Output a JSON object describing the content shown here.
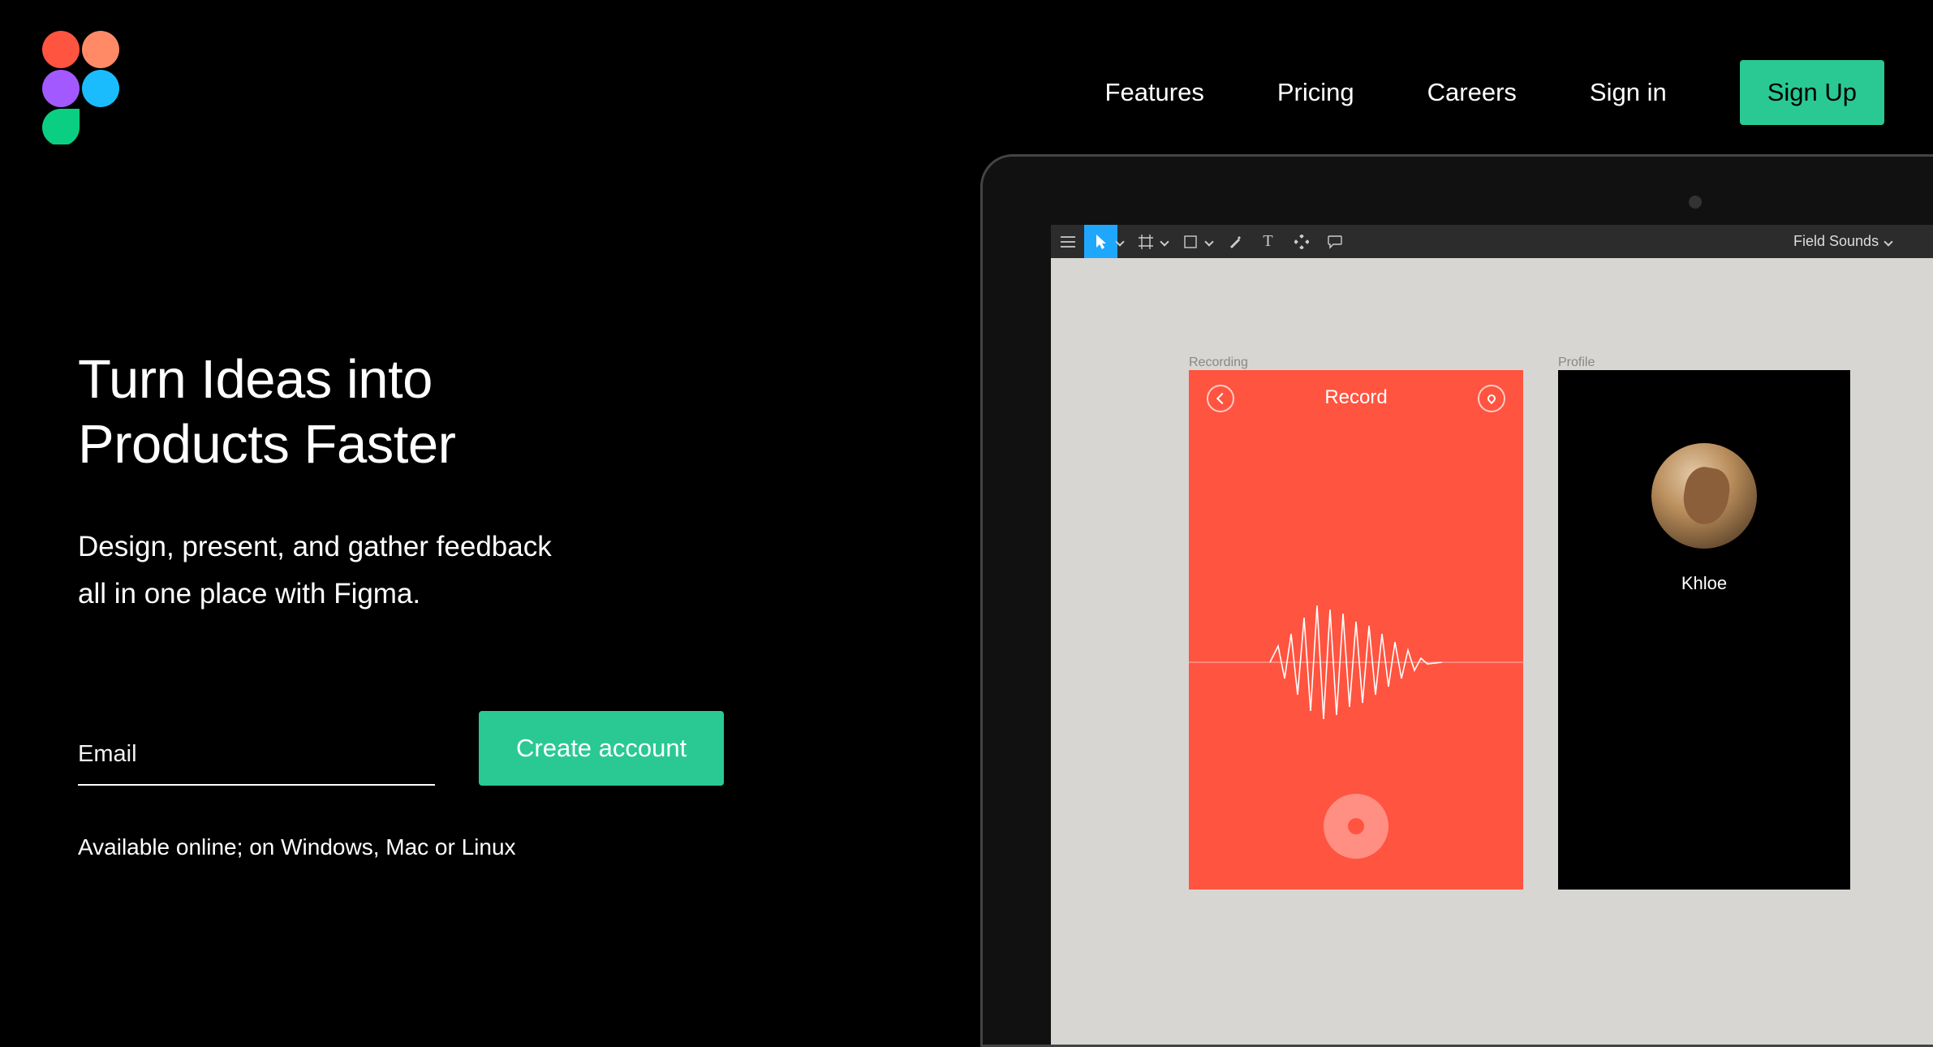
{
  "nav": {
    "features": "Features",
    "pricing": "Pricing",
    "careers": "Careers",
    "signin": "Sign in",
    "signup": "Sign Up"
  },
  "hero": {
    "title_line1": "Turn Ideas into",
    "title_line2": "Products Faster",
    "subtitle_line1": "Design, present, and gather feedback",
    "subtitle_line2": "all in one place with Figma.",
    "email_placeholder": "Email",
    "create_button": "Create account",
    "availability": "Available online; on Windows, Mac or Linux"
  },
  "app": {
    "toolbar_title": "Field Sounds",
    "frames": {
      "recording": {
        "label": "Recording",
        "title": "Record"
      },
      "profile": {
        "label": "Profile",
        "name": "Khloe"
      }
    }
  },
  "colors": {
    "accent_green": "#2ac993",
    "accent_blue": "#1ea7fd",
    "record_red": "#ff5440"
  }
}
